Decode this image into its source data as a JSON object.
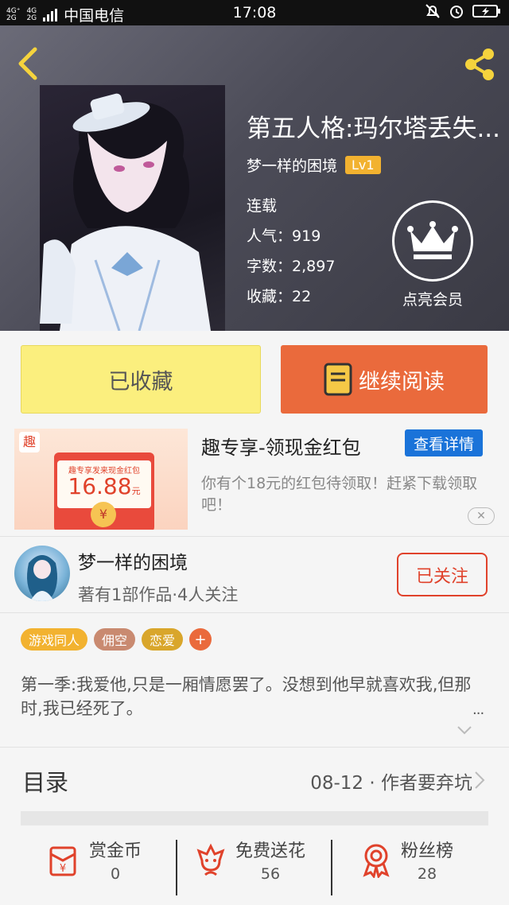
{
  "status_bar": {
    "network_top": "4G⁺",
    "network_bottom": "2G",
    "network2_top": "4G",
    "carrier": "中国电信",
    "time": "17:08"
  },
  "book": {
    "title": "第五人格:玛尔塔丢失...",
    "author": "梦一样的困境",
    "level": "Lv1",
    "status": "连载",
    "popularity_label": "人气：",
    "popularity": "919",
    "words_label": "字数：",
    "words": "2,897",
    "favorites_label": "收藏：",
    "favorites": "22"
  },
  "vip": {
    "label": "点亮会员"
  },
  "actions": {
    "collected": "已收藏",
    "continue_reading": "继续阅读"
  },
  "ad": {
    "title": "趣专享-领现金红包",
    "button": "查看详情",
    "description": "你有个18元的红包待领取！赶紧下载领取吧！",
    "image_logo": "趣",
    "image_caption": "趣专享发来现金红包",
    "image_amount": "16.88",
    "image_unit": "元",
    "close": "✕"
  },
  "author": {
    "name": "梦一样的困境",
    "stats": "著有1部作品·4人关注",
    "follow": "已关注"
  },
  "tags": [
    {
      "label": "游戏同人",
      "color": "#f2b230"
    },
    {
      "label": "佣空",
      "color": "#c98a70"
    },
    {
      "label": "恋爱",
      "color": "#d9a62b"
    }
  ],
  "tag_plus": "+",
  "synopsis": "第一季:我爱他,只是一厢情愿罢了。没想到他早就喜欢我,但那时,我已经死了。",
  "more": "...",
  "catalog": {
    "label": "目录",
    "status": "08-12 · 作者要弃坑"
  },
  "bottom": {
    "reward": {
      "label": "赏金币",
      "count": "0"
    },
    "flowers": {
      "label": "免费送花",
      "count": "56"
    },
    "fans": {
      "label": "粉丝榜",
      "count": "28"
    }
  },
  "colors": {
    "accent_orange": "#ea6a3c",
    "collected_yellow": "#fbef7e",
    "follow_red": "#e0422b",
    "ad_blue": "#1a73d9",
    "icon_red": "#e0422b"
  }
}
